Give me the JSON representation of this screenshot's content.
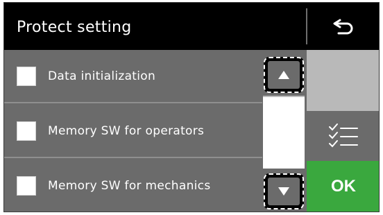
{
  "header": {
    "title": "Protect setting",
    "back_icon": "undo-arrow-icon"
  },
  "items": [
    {
      "label": "Data initialization",
      "checked": false
    },
    {
      "label": "Memory SW for operators",
      "checked": false
    },
    {
      "label": "Memory SW for mechanics",
      "checked": false
    }
  ],
  "scroll": {
    "up_icon": "triangle-up-icon",
    "down_icon": "triangle-down-icon"
  },
  "side": {
    "checklist_icon": "checklist-icon",
    "ok_label": "OK"
  },
  "colors": {
    "header_bg": "#000000",
    "row_bg": "#6b6b6b",
    "ok_green": "#3aa83e",
    "side_gray": "#b9b9b9"
  }
}
